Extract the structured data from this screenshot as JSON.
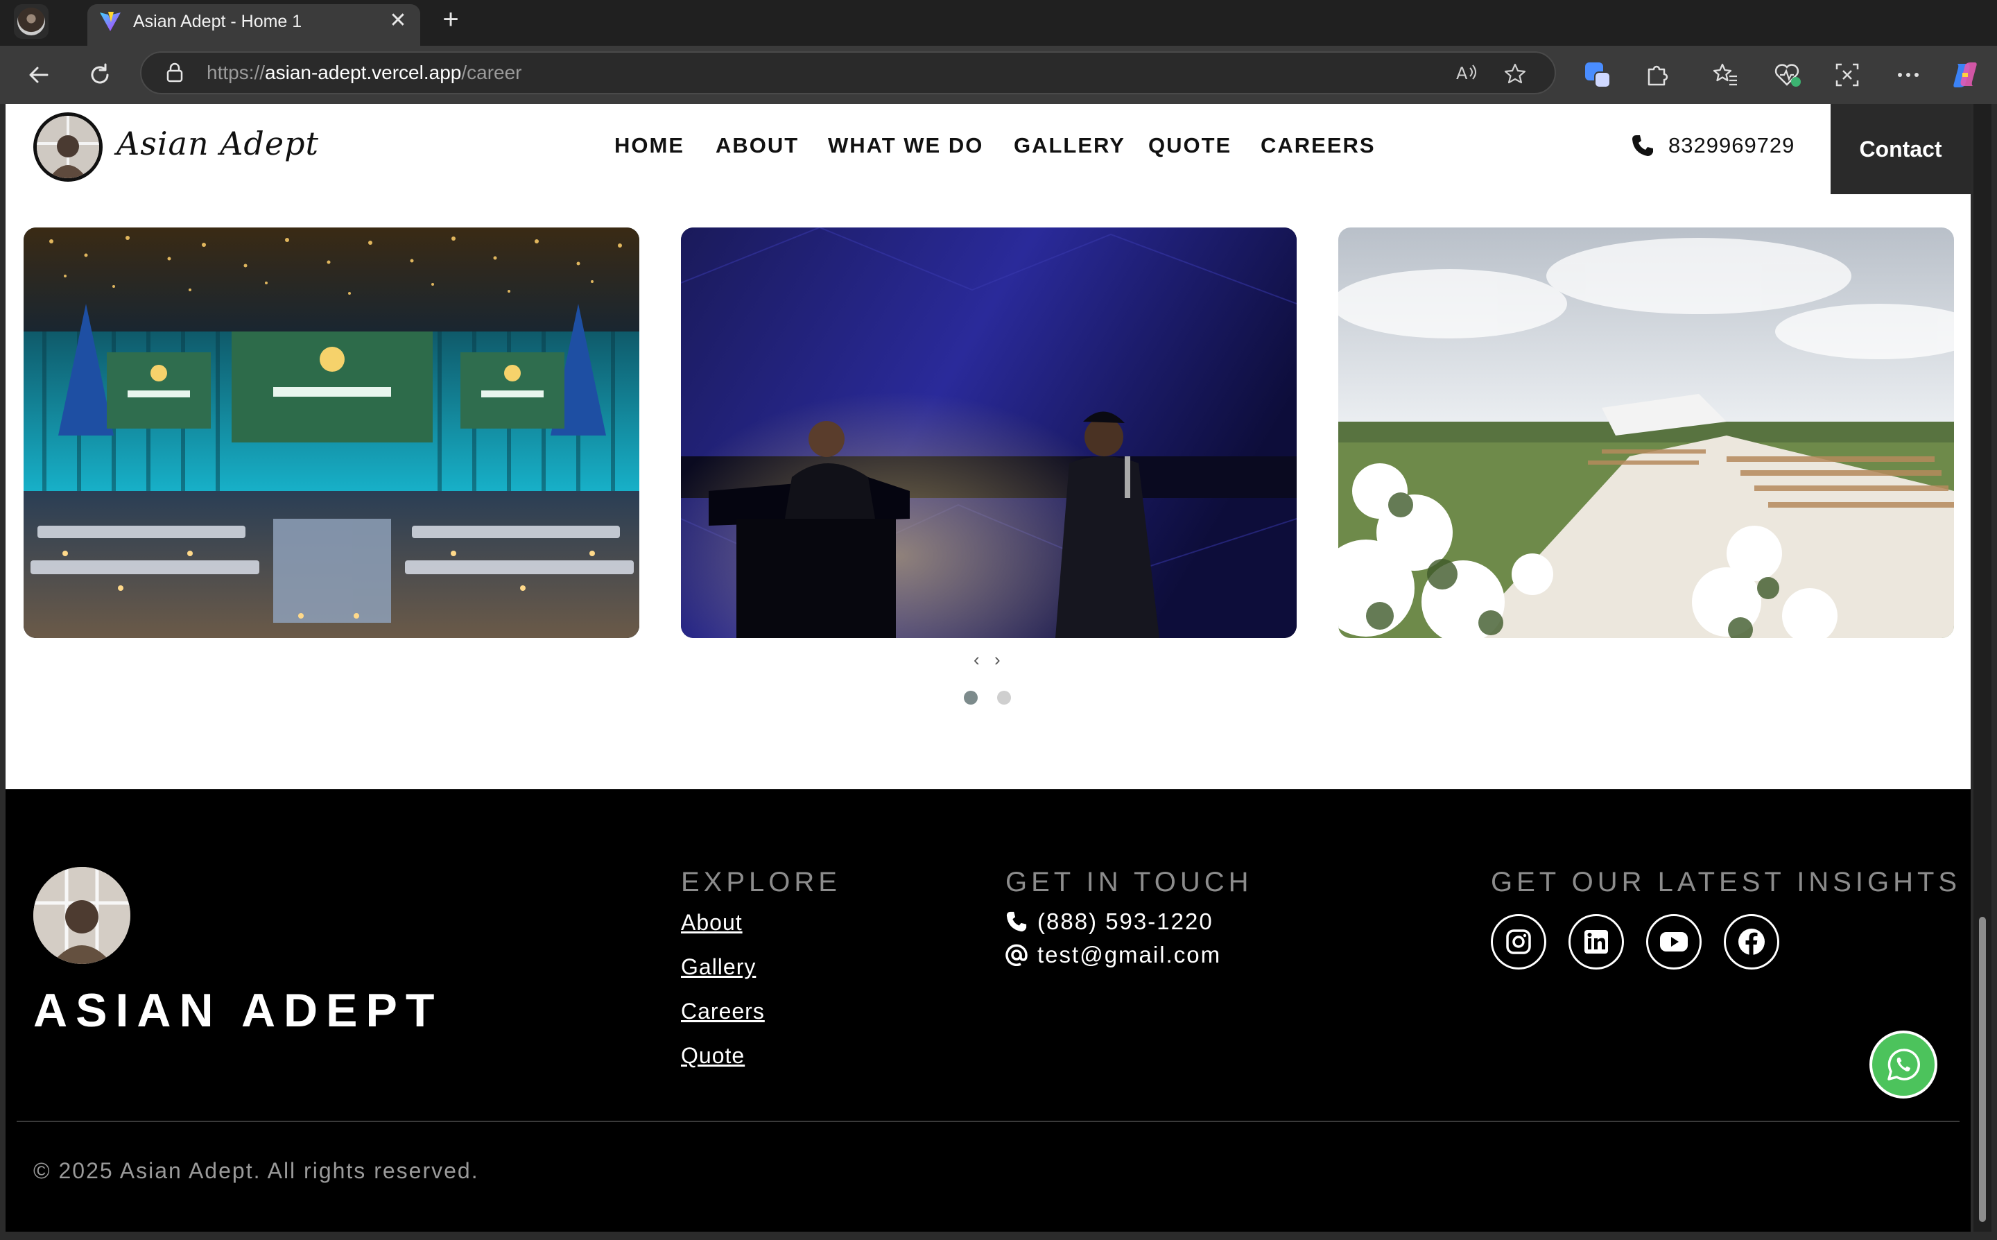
{
  "browser": {
    "tab_title": "Asian Adept - Home 1",
    "close_glyph": "✕",
    "new_tab_glyph": "+",
    "url_scheme": "https://",
    "url_host": "asian-adept.vercel.app",
    "url_path": "/career"
  },
  "site": {
    "logo_text": "Asian Adept",
    "nav": [
      "HOME",
      "ABOUT",
      "WHAT WE DO",
      "GALLERY",
      "QUOTE",
      "CAREERS"
    ],
    "phone": "8329969729",
    "contact_label": "Contact"
  },
  "gallery": {
    "items": [
      {
        "icon": "event-hall-photo"
      },
      {
        "icon": "concert-stage-photo"
      },
      {
        "icon": "outdoor-wedding-photo"
      }
    ],
    "prev_glyph": "‹",
    "next_glyph": "›",
    "active_dot": 0,
    "dot_count": 2
  },
  "footer": {
    "brand": "ASIAN ADEPT",
    "explore_heading": "EXPLORE",
    "explore_links": [
      "About",
      "Gallery",
      "Careers",
      "Quote"
    ],
    "touch_heading": "GET IN TOUCH",
    "phone": "(888) 593-1220",
    "email": "test@gmail.com",
    "insights_heading": "GET OUR LATEST INSIGHTS",
    "socials": [
      "instagram-icon",
      "linkedin-icon",
      "youtube-icon",
      "facebook-icon"
    ],
    "copyright": "© 2025 Asian Adept. All rights reserved."
  },
  "colors": {
    "footer_bg": "#000000",
    "whatsapp": "#4cc35c",
    "contact_btn": "#2a2a2a"
  }
}
